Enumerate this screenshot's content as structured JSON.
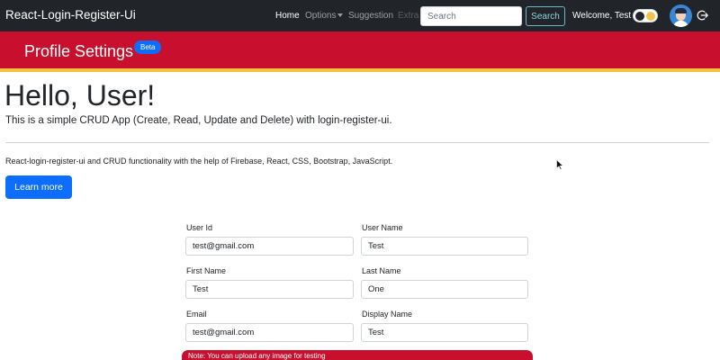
{
  "navbar": {
    "brand": "React-Login-Register-Ui",
    "links": {
      "home": "Home",
      "options": "Options",
      "suggestion": "Suggestion",
      "extra": "Extra"
    },
    "search_placeholder": "Search",
    "search_button": "Search",
    "welcome": "Welcome, Test",
    "icons": {
      "theme_toggle": "sun-moon-toggle-icon",
      "avatar": "user-avatar-icon",
      "logout": "logout-icon",
      "options_caret": "caret-down-icon"
    }
  },
  "header": {
    "title": "Profile Settings",
    "badge": "Beta"
  },
  "hero": {
    "title": "Hello, User!",
    "lead": "This is a simple CRUD App (Create, Read, Update and Delete) with login-register-ui.",
    "text": "React-login-register-ui and CRUD functionality with the help of Firebase, React, CSS, Bootstrap, JavaScript.",
    "button": "Learn more"
  },
  "form": {
    "user_id": {
      "label": "User Id",
      "value": "test@gmail.com"
    },
    "user_name": {
      "label": "User Name",
      "value": "Test"
    },
    "first_name": {
      "label": "First Name",
      "value": "Test"
    },
    "last_name": {
      "label": "Last Name",
      "value": "One"
    },
    "email": {
      "label": "Email",
      "value": "test@gmail.com"
    },
    "display_name": {
      "label": "Display Name",
      "value": "Test"
    }
  },
  "note": "Note: You can upload any image for testing",
  "colors": {
    "navbar_bg": "#212529",
    "band_red": "#c8102e",
    "band_stripe": "#f6c242",
    "primary": "#0d6efd"
  }
}
